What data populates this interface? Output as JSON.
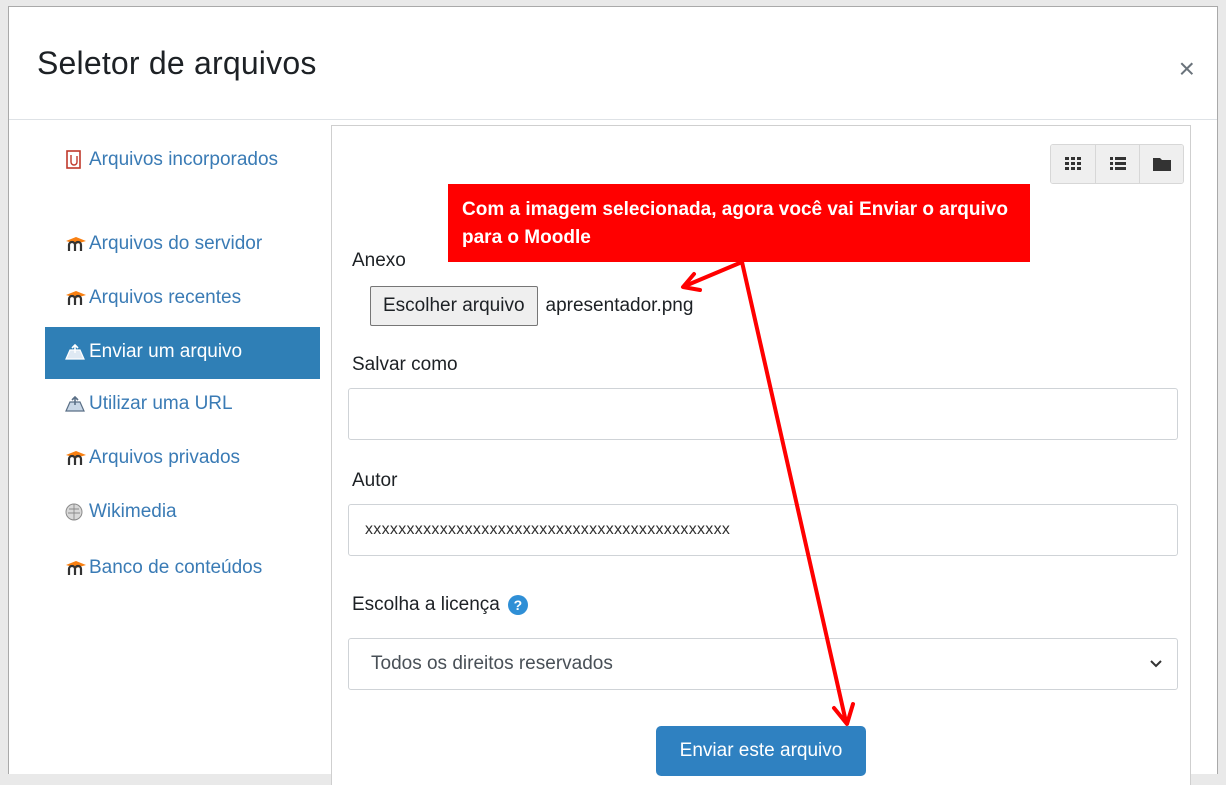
{
  "modal": {
    "title": "Seletor de arquivos",
    "close_glyph": "×"
  },
  "sidebar": {
    "items": [
      {
        "label": "Arquivos incorporados",
        "icon": "embedded-files-icon"
      },
      {
        "label": "Arquivos do servidor",
        "icon": "moodle-icon"
      },
      {
        "label": "Arquivos recentes",
        "icon": "moodle-icon"
      },
      {
        "label": "Enviar um arquivo",
        "icon": "upload-icon",
        "active": true
      },
      {
        "label": "Utilizar uma URL",
        "icon": "url-icon"
      },
      {
        "label": "Arquivos privados",
        "icon": "moodle-icon"
      },
      {
        "label": "Wikimedia",
        "icon": "wikimedia-icon"
      },
      {
        "label": "Banco de conteúdos",
        "icon": "moodle-icon"
      }
    ]
  },
  "toolbar": {
    "view_buttons": [
      "grid-view-icon",
      "list-view-icon",
      "folder-view-icon"
    ]
  },
  "form": {
    "attachment_label": "Anexo",
    "choose_file_button": "Escolher arquivo",
    "chosen_file": "apresentador.png",
    "save_as_label": "Salvar como",
    "save_as_value": "",
    "author_label": "Autor",
    "author_value": "xxxxxxxxxxxxxxxxxxxxxxxxxxxxxxxxxxxxxxxxxxxx",
    "license_label": "Escolha a licença",
    "license_value": "Todos os direitos reservados",
    "submit_button": "Enviar este arquivo"
  },
  "annotation": {
    "text": "Com a imagem selecionada, agora você vai Enviar o arquivo para o Moodle",
    "color": "#ff0000"
  },
  "colors": {
    "accent": "#2f7fb6",
    "link": "#3a7bb5",
    "button": "#2f81c1"
  }
}
